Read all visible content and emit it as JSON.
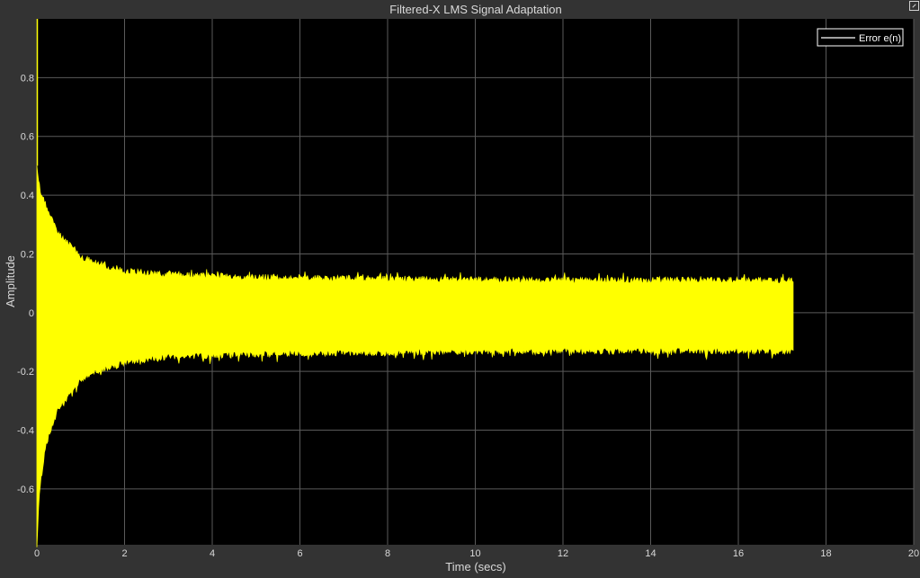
{
  "window": {
    "undock_icon": "undock-arrow-icon"
  },
  "colors": {
    "figure_background": "#333333",
    "axes_background": "#000000",
    "grid": "#5a5a5a",
    "text": "#d9d9d9",
    "signal": "#ffff00",
    "legend_line": "#ffffff"
  },
  "chart_data": {
    "type": "line",
    "title": "Filtered-X LMS Signal Adaptation",
    "xlabel": "Time (secs)",
    "ylabel": "Amplitude",
    "xlim": [
      0,
      20
    ],
    "ylim": [
      -0.79,
      1.0
    ],
    "x_ticks": [
      0,
      2,
      4,
      6,
      8,
      10,
      12,
      14,
      16,
      18,
      20
    ],
    "y_ticks": [
      -0.6,
      -0.4,
      -0.2,
      0,
      0.2,
      0.4,
      0.6,
      0.8
    ],
    "y_tick_labels": [
      "-0.6",
      "-0.4",
      "-0.2",
      "0",
      "0.2",
      "0.4",
      "0.6",
      "0.8"
    ],
    "grid": true,
    "legend_position": "top-right",
    "series": [
      {
        "name": "Error e(n)",
        "color": "#ffff00",
        "legend_color": "#ffffff",
        "description_envelope": "oscillating error signal whose amplitude decays quickly then stays roughly constant",
        "envelope_time": [
          0,
          0.05,
          0.2,
          0.5,
          1.0,
          1.5,
          2.0,
          3.0,
          5.0,
          8.0,
          12.0,
          16.0,
          17.25
        ],
        "envelope_upper": [
          0.5,
          0.43,
          0.36,
          0.27,
          0.19,
          0.16,
          0.14,
          0.13,
          0.12,
          0.115,
          0.11,
          0.11,
          0.11
        ],
        "envelope_lower": [
          -0.79,
          -0.62,
          -0.45,
          -0.32,
          -0.23,
          -0.19,
          -0.17,
          -0.15,
          -0.14,
          -0.135,
          -0.13,
          -0.13,
          -0.13
        ],
        "end_time": 17.25
      }
    ]
  }
}
